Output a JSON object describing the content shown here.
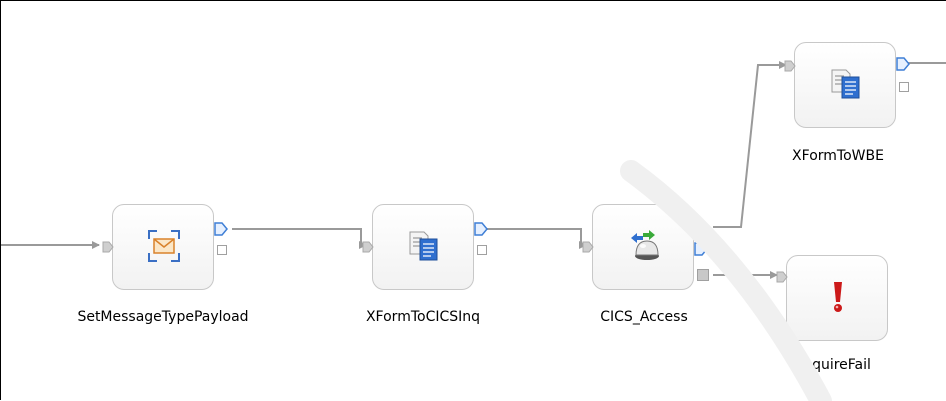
{
  "nodes": [
    {
      "id": "set-message-type-payload",
      "label": "SetMessageTypePayload",
      "icon": "envelope-icon"
    },
    {
      "id": "xform-to-cics-inq",
      "label": "XFormToCICSInq",
      "icon": "transform-document-icon"
    },
    {
      "id": "cics-access",
      "label": "CICS_Access",
      "icon": "cics-connector-icon"
    },
    {
      "id": "xform-to-wbe",
      "label": "XFormToWBE",
      "icon": "transform-document-icon"
    },
    {
      "id": "inquire-fail",
      "label": "InquireFail",
      "icon": "exclamation-icon"
    }
  ],
  "connections": [
    {
      "from": "input",
      "to": "set-message-type-payload"
    },
    {
      "from": "set-message-type-payload",
      "to": "xform-to-cics-inq"
    },
    {
      "from": "xform-to-cics-inq",
      "to": "cics-access"
    },
    {
      "from": "cics-access",
      "to": "xform-to-wbe"
    },
    {
      "from": "cics-access",
      "to": "inquire-fail"
    },
    {
      "from": "xform-to-wbe",
      "to": "output"
    }
  ],
  "colors": {
    "wire": "#9a9a9a",
    "terminal_blue": "#3f7fd6",
    "node_border": "#c8c8c8",
    "envelope": "#d9822b",
    "exclamation": "#cc1a1a"
  }
}
